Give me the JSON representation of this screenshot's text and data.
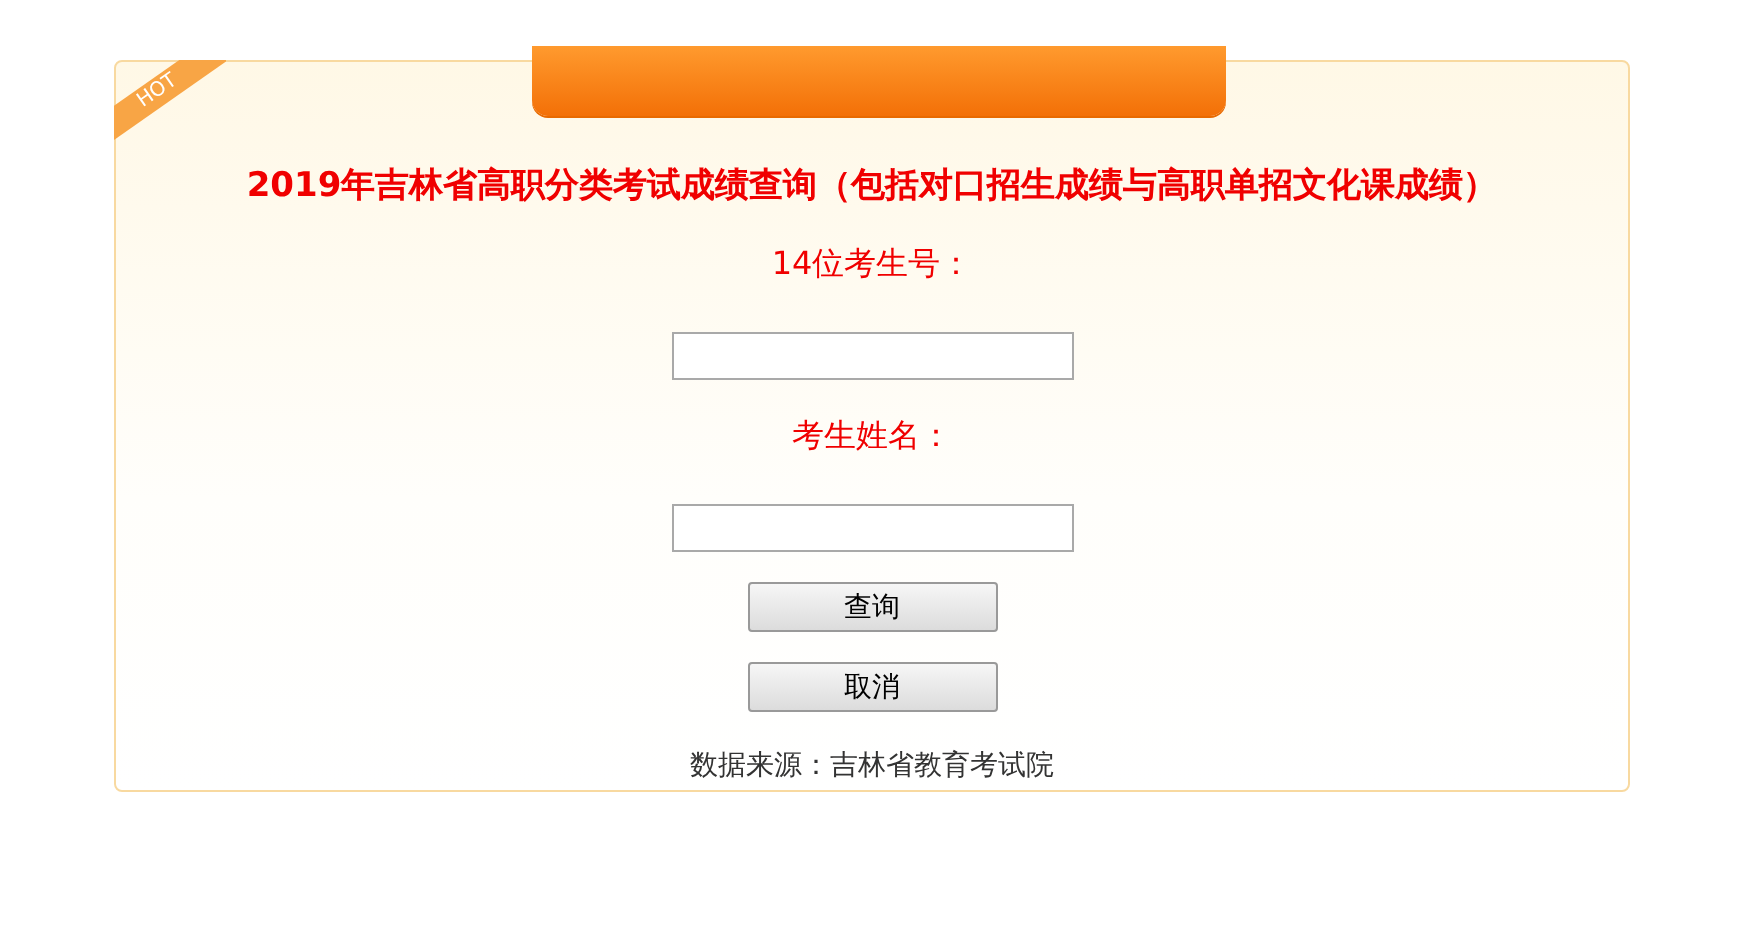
{
  "badge": "HOT",
  "title": "2019年吉林省高职分类考试成绩查询（包括对口招生成绩与高职单招文化课成绩）",
  "fields": [
    {
      "label": "14位考生号："
    },
    {
      "label": "考生姓名："
    }
  ],
  "buttons": [
    {
      "label": "查询"
    },
    {
      "label": "取消"
    }
  ],
  "source": "数据来源：吉林省教育考试院"
}
